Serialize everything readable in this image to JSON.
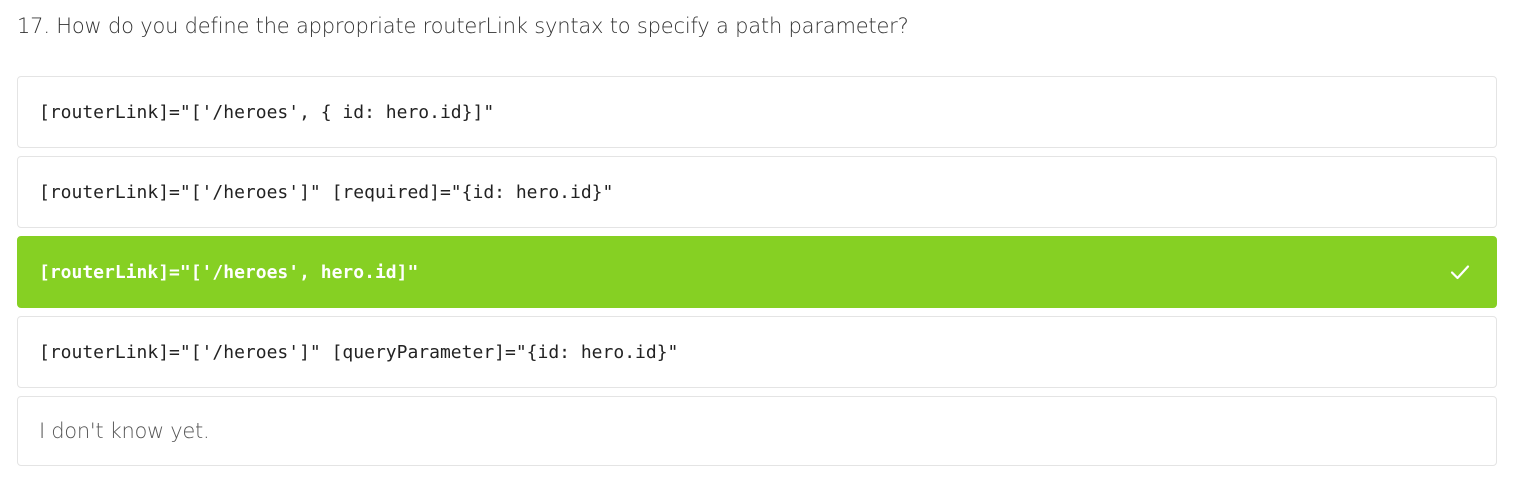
{
  "question": {
    "text": "17. How do you define the appropriate routerLink syntax to specify a path parameter?"
  },
  "options": [
    {
      "text": "[routerLink]=\"['/heroes', { id: hero.id}]\"",
      "selected": false,
      "code": true
    },
    {
      "text": "[routerLink]=\"['/heroes']\" [required]=\"{id: hero.id}\"",
      "selected": false,
      "code": true
    },
    {
      "text": "[routerLink]=\"['/heroes', hero.id]\"",
      "selected": true,
      "code": true,
      "icon": "checkmark-icon"
    },
    {
      "text": "[routerLink]=\"['/heroes']\" [queryParameter]=\"{id: hero.id}\"",
      "selected": false,
      "code": true
    },
    {
      "text": "I don't know yet.",
      "selected": false,
      "code": false
    }
  ],
  "colors": {
    "selected_bg": "#86d023",
    "border": "#e4e4e4",
    "text": "#222222"
  }
}
